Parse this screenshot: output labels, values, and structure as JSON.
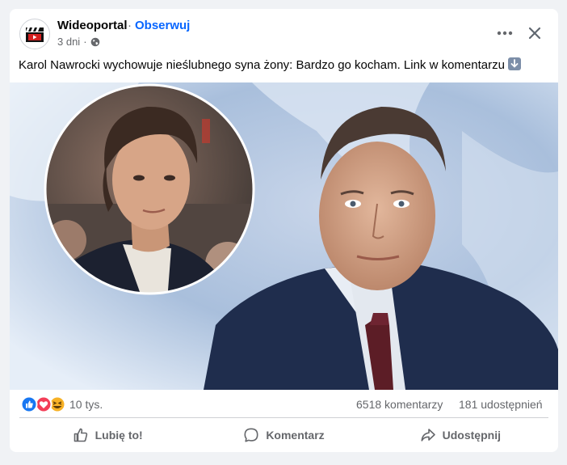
{
  "post": {
    "page_name": "Wideoportal",
    "separator": "·",
    "follow_label": "Obserwuj",
    "time_ago": "3 dni",
    "meta_separator": "·",
    "caption": "Karol Nawrocki wychowuje nieślubnego syna żony: Bardzo go kocham. Link w komentarzu"
  },
  "icons": {
    "avatar": "video-clapper-icon",
    "privacy": "globe-icon",
    "more": "more-horizontal-icon",
    "close": "close-icon",
    "caption_emoji": "arrow-down-emoji-icon",
    "like_reaction": "like-reaction-icon",
    "love_reaction": "love-reaction-icon",
    "haha_reaction": "haha-reaction-icon",
    "like_action": "thumbs-up-icon",
    "comment_action": "comment-bubble-icon",
    "share_action": "share-arrow-icon"
  },
  "stats": {
    "reactions_count": "10 tys.",
    "comments": "6518 komentarzy",
    "shares": "181 udostępnień"
  },
  "actions": {
    "like": "Lubię to!",
    "comment": "Komentarz",
    "share": "Udostępnij"
  },
  "colors": {
    "accent": "#0866ff",
    "secondary_text": "#65676b",
    "like_blue": "#1877f2",
    "love_red": "#f33e58",
    "haha_yellow": "#f7b125",
    "background": "#f0f2f5"
  }
}
